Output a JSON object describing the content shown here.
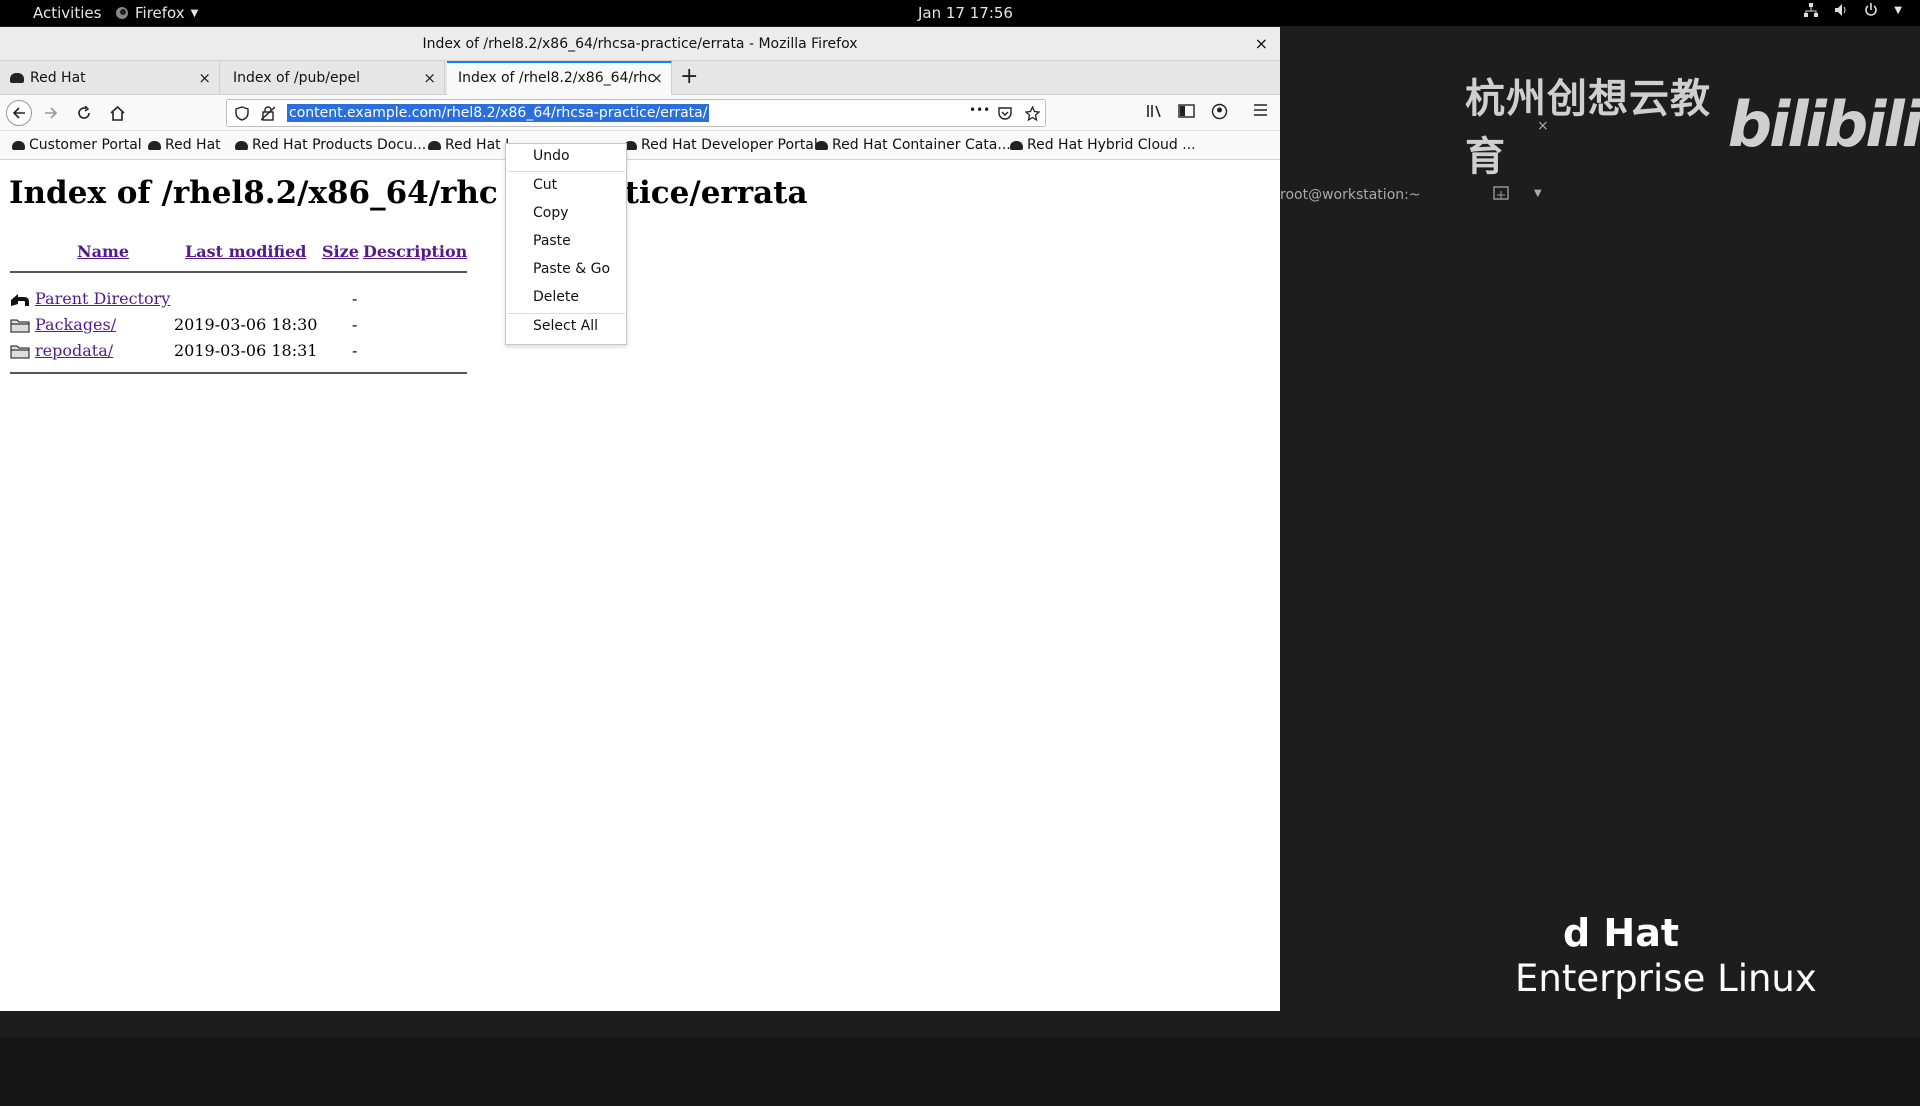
{
  "topbar": {
    "activities": "Activities",
    "app_name": "Firefox",
    "clock": "Jan 17  17:56"
  },
  "watermark": {
    "cn_text": "杭州创想云教育",
    "bili_text": "bilibili",
    "close": "×"
  },
  "background_terminal": {
    "title": "root@workstation:~"
  },
  "rh_logo": {
    "line1": "d Hat",
    "line2": "Enterprise Linux"
  },
  "window": {
    "title": "Index of /rhel8.2/x86_64/rhcsa-practice/errata - Mozilla Firefox",
    "close": "×"
  },
  "tabs": [
    {
      "label": "Red Hat",
      "close": "×"
    },
    {
      "label": "Index of /pub/epel",
      "close": "×"
    },
    {
      "label": "Index of /rhel8.2/x86_64/rhc",
      "close": "×"
    }
  ],
  "new_tab": "+",
  "navbar": {
    "url": "content.example.com/rhel8.2/x86_64/rhcsa-practice/errata/",
    "more": "•••"
  },
  "bookmarks": [
    "Customer Portal",
    "Red Hat",
    "Red Hat Products Docu...",
    "Red Hat I",
    "Red Hat Developer Portal",
    "Red Hat Container Cata...",
    "Red Hat Hybrid Cloud ..."
  ],
  "page": {
    "heading_left": "Index of /rhel8.2/x86_64/rhc",
    "heading_right": "ctice/errata",
    "columns": {
      "name": "Name",
      "modified": "Last modified",
      "size": "Size",
      "description": "Description"
    },
    "rows": [
      {
        "name": "Parent Directory",
        "date": "",
        "size": "-",
        "icon": "parent-dir-icon"
      },
      {
        "name": "Packages/",
        "date": "2019-03-06 18:30",
        "size": "-",
        "icon": "folder-icon"
      },
      {
        "name": "repodata/",
        "date": "2019-03-06 18:31",
        "size": "-",
        "icon": "folder-icon"
      }
    ]
  },
  "context_menu": {
    "items": [
      "Undo",
      "Cut",
      "Copy",
      "Paste",
      "Paste & Go",
      "Delete",
      "Select All"
    ]
  }
}
